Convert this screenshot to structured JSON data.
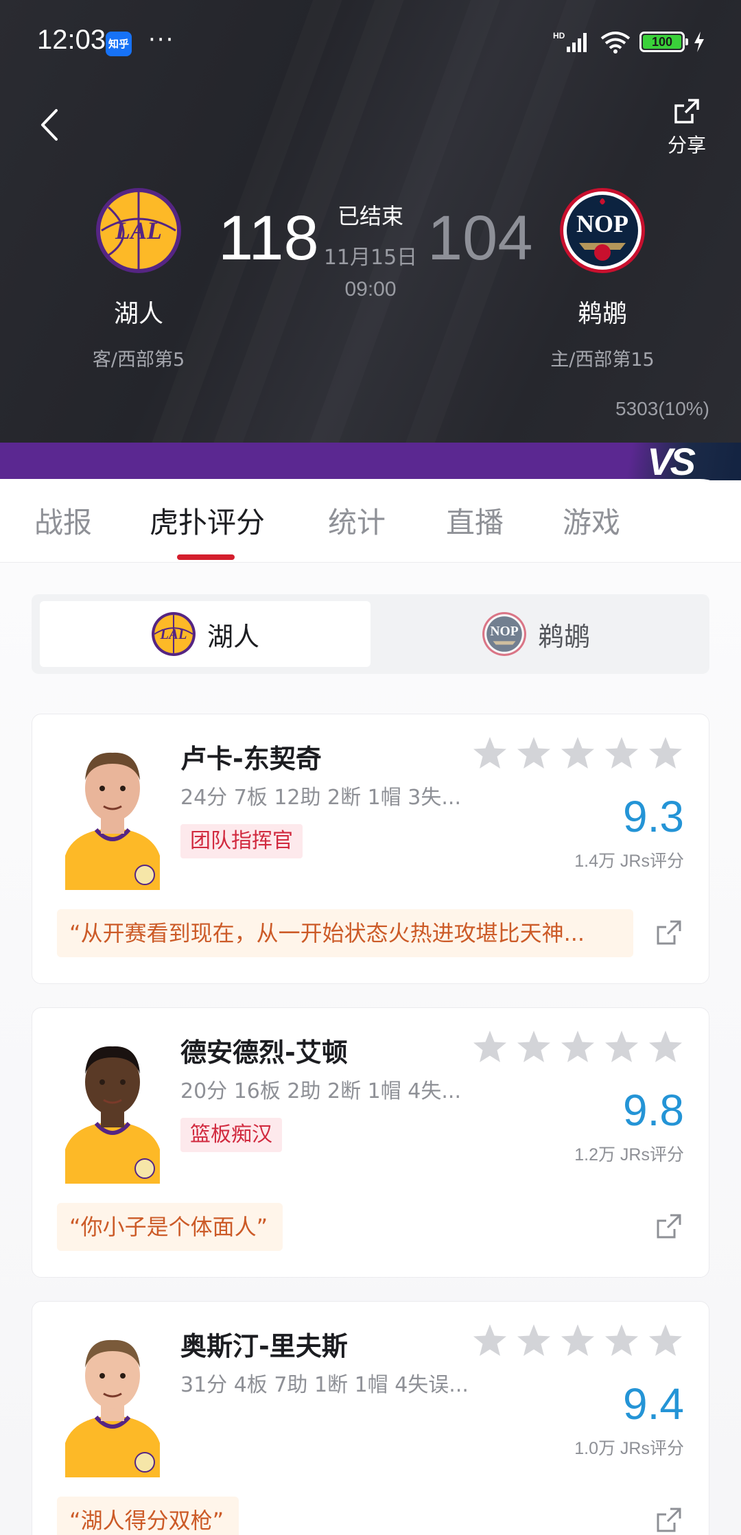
{
  "status_bar": {
    "time": "12:03",
    "app_badge": "知乎",
    "dots": "···",
    "network": "HD",
    "battery": "100"
  },
  "header": {
    "share_label": "分享",
    "home_team": {
      "name": "湖人",
      "sub": "客/西部第5",
      "score": "118",
      "logo_text": "LAL"
    },
    "away_team": {
      "name": "鹈鹕",
      "sub": "主/西部第15",
      "score": "104",
      "logo_text": "NOP"
    },
    "game_status": "已结束",
    "game_date": "11月15日",
    "game_time": "09:00",
    "vote_count": "5303(10%)",
    "vs_mark": "VS"
  },
  "tabs": [
    {
      "label": "战报",
      "active": false
    },
    {
      "label": "虎扑评分",
      "active": true
    },
    {
      "label": "统计",
      "active": false
    },
    {
      "label": "直播",
      "active": false
    },
    {
      "label": "游戏",
      "active": false
    }
  ],
  "team_switch": {
    "home": "湖人",
    "away": "鹈鹕"
  },
  "players": [
    {
      "name": "卢卡-东契奇",
      "stats": "24分 7板 12助 2断 1帽 3失...",
      "tag": "团队指挥官",
      "rating": "9.3",
      "rating_count": "1.4万 JRs评分",
      "comment": "“从开赛看到现在，从一开始状态火热进攻堪比天神...",
      "skin": "#e9b59a",
      "hair": "#6b4a2e"
    },
    {
      "name": "德安德烈-艾顿",
      "stats": "20分 16板 2助 2断 1帽 4失...",
      "tag": "篮板痴汉",
      "rating": "9.8",
      "rating_count": "1.2万 JRs评分",
      "comment": "“你小子是个体面人”",
      "skin": "#5a3a26",
      "hair": "#1a1210"
    },
    {
      "name": "奥斯汀-里夫斯",
      "stats": "31分 4板 7助 1断 1帽 4失误...",
      "tag": "",
      "rating": "9.4",
      "rating_count": "1.0万 JRs评分",
      "comment": "“湖人得分双枪”",
      "skin": "#efc1a5",
      "hair": "#7a5a3a"
    }
  ],
  "colors": {
    "accent_red": "#d41e2d",
    "rating_blue": "#2494d6",
    "lakers_purple": "#552583",
    "lakers_gold": "#fdb927",
    "pelicans_navy": "#0c2340",
    "pelicans_red": "#c8102e"
  }
}
